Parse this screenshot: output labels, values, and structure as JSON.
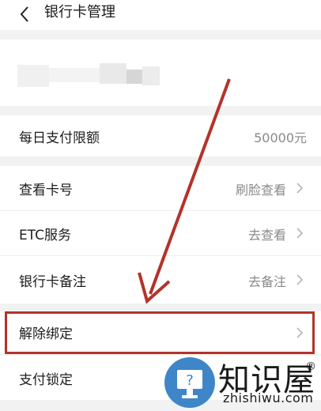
{
  "header": {
    "title": "银行卡管理",
    "back_icon": "back-chevron-icon"
  },
  "rows": [
    {
      "label": "每日支付限额",
      "value": "50000元",
      "has_chevron": false
    },
    {
      "label": "查看卡号",
      "value": "刷脸查看",
      "has_chevron": true
    },
    {
      "label": "ETC服务",
      "value": "去查看",
      "has_chevron": true
    },
    {
      "label": "银行卡备注",
      "value": "去备注",
      "has_chevron": true
    },
    {
      "label": "解除绑定",
      "value": "",
      "has_chevron": true
    },
    {
      "label": "支付锁定",
      "value": "",
      "has_chevron": false
    }
  ],
  "annotation": {
    "color": "#b3332a"
  },
  "watermark": {
    "name": "知识屋",
    "registered_mark": "®",
    "url": "zhishiwu.com",
    "icon": "monitor-question-icon"
  }
}
